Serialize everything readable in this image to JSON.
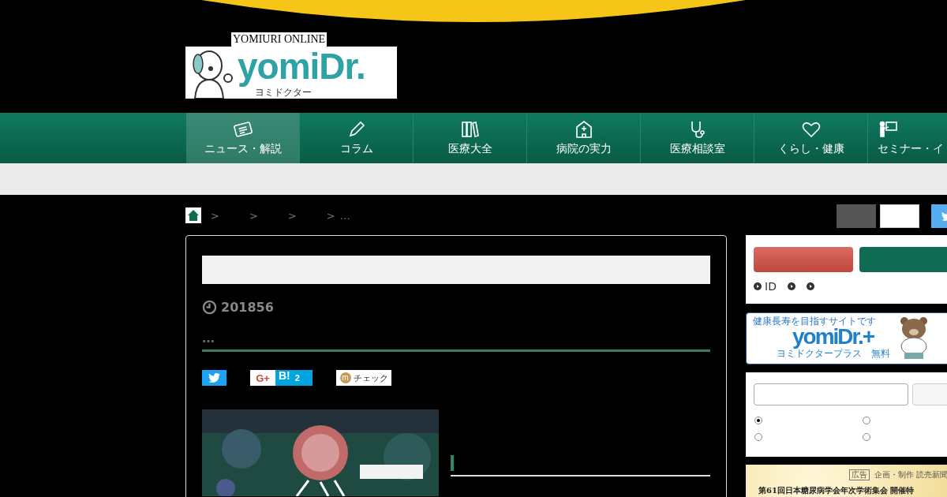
{
  "logo": {
    "tagline": "YOMIURI ONLINE",
    "name": "yomiDr.",
    "reading": "ヨミドクター"
  },
  "nav": [
    {
      "label": "ニュース・解説",
      "selected": true
    },
    {
      "label": "コラム",
      "selected": false
    },
    {
      "label": "医療大全",
      "selected": false
    },
    {
      "label": "病院の実力",
      "selected": false
    },
    {
      "label": "医療相談室",
      "selected": false
    },
    {
      "label": "くらし・健康",
      "selected": false
    },
    {
      "label": "セミナー・イ",
      "selected": false
    }
  ],
  "breadcrumb": {
    "separators": [
      ">",
      ">",
      ">",
      ">"
    ],
    "tail": "…"
  },
  "article": {
    "date": "201856",
    "lead": "…",
    "share": {
      "gplus": "G+",
      "hatena": "B!",
      "hatena_count": "2",
      "check_icon": "m",
      "check": "チェック"
    }
  },
  "sidebar": {
    "links": [
      {
        "kind": "labeled",
        "label": "ID"
      },
      {
        "kind": "bare"
      },
      {
        "kind": "bare"
      }
    ],
    "promo": {
      "tagline": "健康長寿を目指すサイトです",
      "name": "yomiDr.+",
      "reading": "ヨミドクタープラス",
      "price": "無料"
    },
    "search": {
      "options": [
        {
          "selected": true
        },
        {
          "selected": false
        },
        {
          "selected": false
        },
        {
          "selected": false
        }
      ]
    },
    "ad": {
      "badge": "広告",
      "credit": "企画・制作 読売新聞",
      "headline": "第61回日本糖尿病学会年次学術集会 開催特"
    }
  }
}
